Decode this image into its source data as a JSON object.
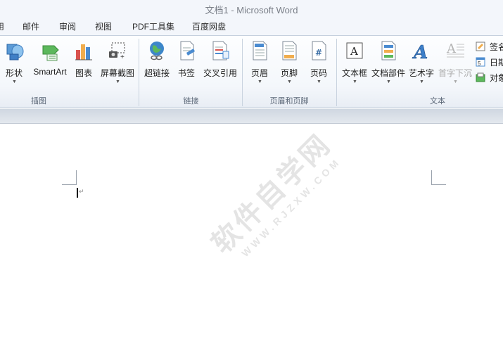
{
  "window": {
    "title": "文档1 - Microsoft Word"
  },
  "menu_tabs": [
    "用",
    "邮件",
    "审阅",
    "视图",
    "PDF工具集",
    "百度网盘"
  ],
  "ribbon": {
    "groups": {
      "illustrations": {
        "label": "插图",
        "buttons": {
          "shapes": "形状",
          "smartart": "SmartArt",
          "chart": "图表",
          "screenshot": "屏幕截图"
        }
      },
      "links": {
        "label": "链接",
        "buttons": {
          "hyperlink": "超链接",
          "bookmark": "书签",
          "cross_reference": "交叉引用"
        }
      },
      "header_footer": {
        "label": "页眉和页脚",
        "buttons": {
          "header": "页眉",
          "footer": "页脚",
          "page_number": "页码"
        }
      },
      "text": {
        "label": "文本",
        "buttons": {
          "text_box": "文本框",
          "quick_parts": "文档部件",
          "wordart": "艺术字",
          "drop_cap": "首字下沉"
        },
        "small_buttons": {
          "signature_line": "签名",
          "date_time": "日期",
          "object": "对象"
        }
      }
    }
  },
  "document": {
    "paragraph_mark": "↵"
  },
  "watermark": {
    "main": "软件自学网",
    "sub": "WWW.RJZXW.COM"
  },
  "colors": {
    "ribbon_bg": "#f4f7fb",
    "doc_bg": "#e3e8ee",
    "page": "#ffffff",
    "title_text": "#7a7f88"
  }
}
